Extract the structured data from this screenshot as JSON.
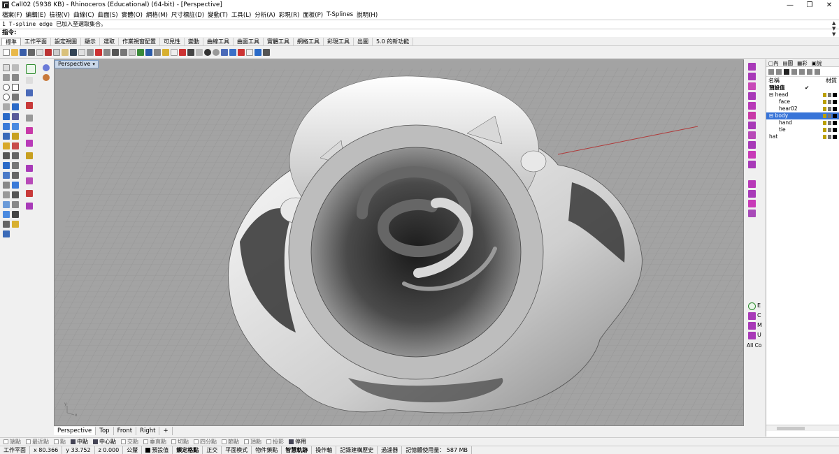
{
  "window": {
    "title": "Call02 (5938 KB) - Rhinoceros (Educational) (64-bit) - [Perspective]",
    "minimize": "—",
    "maximize": "❐",
    "close": "✕"
  },
  "menu": [
    "檔案(F)",
    "編輯(E)",
    "檢視(V)",
    "曲線(C)",
    "曲面(S)",
    "實體(O)",
    "網格(M)",
    "尺寸標註(D)",
    "變動(T)",
    "工具(L)",
    "分析(A)",
    "彩現(R)",
    "面板(P)",
    "T-Splines",
    "說明(H)"
  ],
  "command": {
    "history": "1 T-spline edge 已加入至選取集合。",
    "prompt": "指令:"
  },
  "toolbar_tabs": [
    "標準",
    "工作平面",
    "設定視圖",
    "顯示",
    "選取",
    "作業視窗配置",
    "可見性",
    "變動",
    "曲線工具",
    "曲面工具",
    "實體工具",
    "網格工具",
    "彩現工具",
    "出圖",
    "5.0 的新功能"
  ],
  "viewport": {
    "label": "Perspective",
    "tabs": [
      "Perspective",
      "Top",
      "Front",
      "Right",
      "+"
    ]
  },
  "right_strip": {
    "letters": [
      "E",
      "C",
      "M",
      "U"
    ],
    "all_co": "All Co"
  },
  "layers_panel": {
    "col_name": "名稱",
    "col_material": "材質",
    "layers": [
      {
        "name": "預設值",
        "indent": 0,
        "check": "✔"
      },
      {
        "name": "head",
        "indent": 0,
        "check": ""
      },
      {
        "name": "face",
        "indent": 1,
        "check": ""
      },
      {
        "name": "hear02",
        "indent": 1,
        "check": ""
      },
      {
        "name": "body",
        "indent": 0,
        "check": ""
      },
      {
        "name": "hand",
        "indent": 1,
        "check": ""
      },
      {
        "name": "tie",
        "indent": 1,
        "check": ""
      },
      {
        "name": "hat",
        "indent": 0,
        "check": ""
      }
    ]
  },
  "osnaps": [
    {
      "label": "端點",
      "on": false
    },
    {
      "label": "最近點",
      "on": false
    },
    {
      "label": "點",
      "on": false
    },
    {
      "label": "中點",
      "on": true
    },
    {
      "label": "中心點",
      "on": true
    },
    {
      "label": "交點",
      "on": false
    },
    {
      "label": "垂直點",
      "on": false
    },
    {
      "label": "切點",
      "on": false
    },
    {
      "label": "四分點",
      "on": false
    },
    {
      "label": "節點",
      "on": false
    },
    {
      "label": "頂點",
      "on": false
    },
    {
      "label": "投影",
      "on": false
    },
    {
      "label": "停用",
      "on": true
    }
  ],
  "status": {
    "cplane": "工作平面",
    "x": "x 80.366",
    "y": "y 33.752",
    "z": "z 0.000",
    "units": "公釐",
    "layer": "預設值",
    "grid_snap": "鎖定格點",
    "ortho": "正交",
    "planar": "平面模式",
    "osnap": "物件鎖點",
    "smarttrack": "智慧軌跡",
    "gumball": "操作軸",
    "history": "記錄建構歷史",
    "filter": "過濾器",
    "memory": "記憶體使用量： 587 MB"
  },
  "colors": {
    "selection": "#3874d8",
    "viewport_bg": "#a3a3a3",
    "grid_line": "#8f8f8f",
    "x_axis": "#b03a3a",
    "y_axis": "#3a9a3a"
  }
}
